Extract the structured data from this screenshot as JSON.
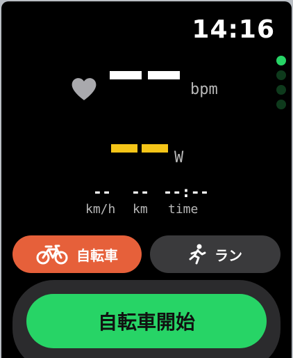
{
  "status_bar": {
    "time": "14:16"
  },
  "page_indicator": {
    "count": 4,
    "active_index": 0
  },
  "heart_rate": {
    "value": "",
    "unit": "bpm"
  },
  "power": {
    "value": "",
    "unit": "W"
  },
  "stats": [
    {
      "value": "--",
      "label": "km/h"
    },
    {
      "value": "--",
      "label": "km"
    },
    {
      "value": "--:--",
      "label": "time"
    }
  ],
  "modes": {
    "bike_label": "自転車",
    "run_label": "ラン",
    "bike_icon": "bicycle-icon",
    "run_icon": "runner-icon"
  },
  "start_button": {
    "label": "自転車開始"
  },
  "colors": {
    "background": "#000000",
    "accent_green": "#27d466",
    "bike_orange": "#e6603a",
    "power_yellow": "#f5c518"
  }
}
